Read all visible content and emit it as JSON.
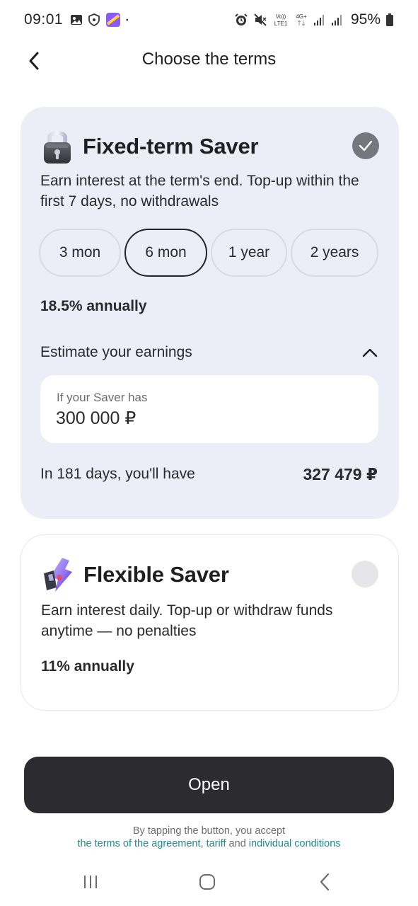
{
  "status_bar": {
    "time": "09:01",
    "battery": "95%",
    "left_icons": [
      "gallery-icon",
      "shield-icon",
      "app-icon",
      "dot-icon"
    ],
    "right_icons": [
      "alarm-icon",
      "mute-icon",
      "volte-icon",
      "4g-icon",
      "signal-icon",
      "signal-icon",
      "battery-icon"
    ]
  },
  "header": {
    "title": "Choose the terms",
    "back_icon": "chevron-left-icon"
  },
  "fixed_saver": {
    "title": "Fixed-term Saver",
    "icon": "padlock-icon",
    "selected": true,
    "description": "Earn interest at the term's end. Top-up within the first 7 days, no withdrawals",
    "terms": [
      "3 mon",
      "6 mon",
      "1 year",
      "2 years"
    ],
    "selected_term": "6 mon",
    "rate": "18.5% annually",
    "estimate_label": "Estimate your earnings",
    "amount_caption": "If your Saver has",
    "amount_value": "300 000 ₽",
    "result_label": "In 181 days, you'll have",
    "result_value": "327 479 ₽"
  },
  "flexible_saver": {
    "title": "Flexible Saver",
    "icon": "bolt-icon",
    "selected": false,
    "description": "Earn interest daily. Top-up or withdraw funds anytime — no penalties",
    "rate": "11% annually"
  },
  "footer": {
    "open_label": "Open",
    "legal_line1": "By tapping the button, you accept",
    "legal_link1": "the terms of the agreement",
    "legal_sep1": ", ",
    "legal_link2": "tariff",
    "legal_sep2": " and ",
    "legal_link3": "individual conditions"
  },
  "colors": {
    "card_selected_bg": "#ededf8",
    "button_dark": "#2b2b30",
    "link": "#1f8a8a",
    "check_selected": "#76767f"
  },
  "navbar": {
    "icons": [
      "recents-icon",
      "home-icon",
      "back-icon"
    ]
  }
}
